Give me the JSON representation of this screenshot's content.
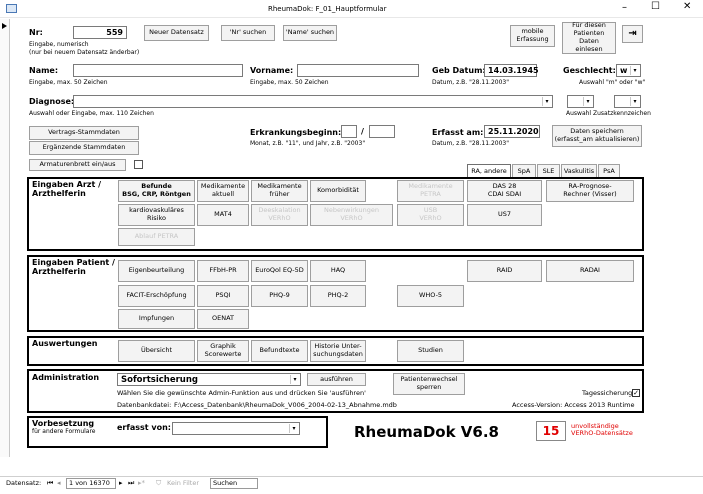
{
  "window": {
    "title": "RheumaDok: F_01_Hauptformular"
  },
  "nr": {
    "label": "Nr:",
    "value": "559",
    "hint": "Eingabe, numerisch",
    "hint2": "(nur bei neuem Datensatz änderbar)"
  },
  "top_buttons": {
    "new_record": "Neuer Datensatz",
    "search_nr": "'Nr' suchen",
    "search_name": "'Name' suchen",
    "mobile": "mobile\nErfassung",
    "load": "Für diesen\nPatienten Daten\neinlesen"
  },
  "name": {
    "label": "Name:",
    "hint": "Eingabe, max. 50 Zeichen"
  },
  "vorname": {
    "label": "Vorname:",
    "hint": "Eingabe, max. 50 Zeichen"
  },
  "geb": {
    "label": "Geb Datum:",
    "value": "14.03.1945",
    "hint": "Datum, z.B. \"28.11.2003\""
  },
  "geschlecht": {
    "label": "Geschlecht:",
    "value": "w",
    "hint": "Auswahl \"m\" oder \"w\""
  },
  "diagnose": {
    "label": "Diagnose:",
    "hint": "Auswahl oder Eingabe, max. 110 Zeichen",
    "hint2": "Auswahl Zusatzkennzeichen"
  },
  "stamm": {
    "vertrag": "Vertrags-Stammdaten",
    "ergaenzend": "Ergänzende Stammdaten"
  },
  "erkrankung": {
    "label": "Erkrankungsbeginn:",
    "sep": "/",
    "hint": "Monat, z.B. \"11\", und Jahr, z.B. \"2003\""
  },
  "erfasst": {
    "label": "Erfasst am:",
    "value": "25.11.2020",
    "hint": "Datum, z.B. \"28.11.2003\""
  },
  "save": "Daten speichern\n(erfasst_am aktualisieren)",
  "dashboard": "Armaturenbrett ein/aus",
  "tabs": [
    "RA, andere",
    "SpA",
    "SLE",
    "Vaskulitis",
    "PsA"
  ],
  "arzt": {
    "title": "Eingaben Arzt /\nArzthelferin",
    "buttons": [
      "Befunde\nBSG, CRP, Röntgen",
      "Medikamente\naktuell",
      "Medikamente\nfrüher",
      "Komorbidität",
      "Medikamente\nPETRA",
      "kardiovaskuläres\nRisiko",
      "MAT4",
      "Deeskalation\nVERhO",
      "Nebenwirkungen\nVERhO",
      "USB\nVERhO",
      "Ablauf PETRA"
    ],
    "right": [
      "DAS 28\nCDAI SDAI",
      "RA-Prognose-\nRechner (Visser)",
      "US7"
    ]
  },
  "patient": {
    "title": "Eingaben Patient /\nArzthelferin",
    "buttons": [
      "Eigenbeurteilung",
      "FFbH-PR",
      "EuroQol EQ-5D",
      "HAQ",
      "FACIT-Erschöpfung",
      "PSQI",
      "PHQ-9",
      "PHQ-2",
      "WHO-5",
      "Impfungen",
      "OENAT"
    ],
    "right": [
      "RAID",
      "RADAI"
    ]
  },
  "auswertungen": {
    "title": "Auswertungen",
    "buttons": [
      "Übersicht",
      "Graphik\nScorewerte",
      "Befundtexte",
      "Historie Unter-\nsuchungsdaten",
      "Studien"
    ]
  },
  "admin": {
    "title": "Administration",
    "combo": "Sofortsicherung",
    "run": "ausführen",
    "pw": "Patientenwechsel\nsperren",
    "hint": "Wählen Sie die gewünschte Admin-Funktion aus und drücken Sie 'ausführen'",
    "tages": "Tagessicherung:",
    "db_label": "Datenbankdatei:",
    "db_path": "F:\\Access_Datenbank\\RheumaDok_V006_2004-02-13_Abnahme.mdb",
    "version": "Access-Version: Access 2013 Runtime"
  },
  "vorbesetzung": {
    "title": "Vorbesetzung",
    "sub": "für andere Formulare",
    "erfasst_von": "erfasst von:"
  },
  "app": {
    "name": "RheumaDok  V6.8",
    "count": "15",
    "count_text": "unvollständige\nVERhO-Datensätze"
  },
  "status": {
    "prefix": "Datensatz:",
    "record": "1 von 16370",
    "filter": "Kein Filter",
    "search": "Suchen"
  },
  "colors": {
    "border": "#000000",
    "count_red": "#e00000",
    "titlebar": "#ffffff"
  }
}
